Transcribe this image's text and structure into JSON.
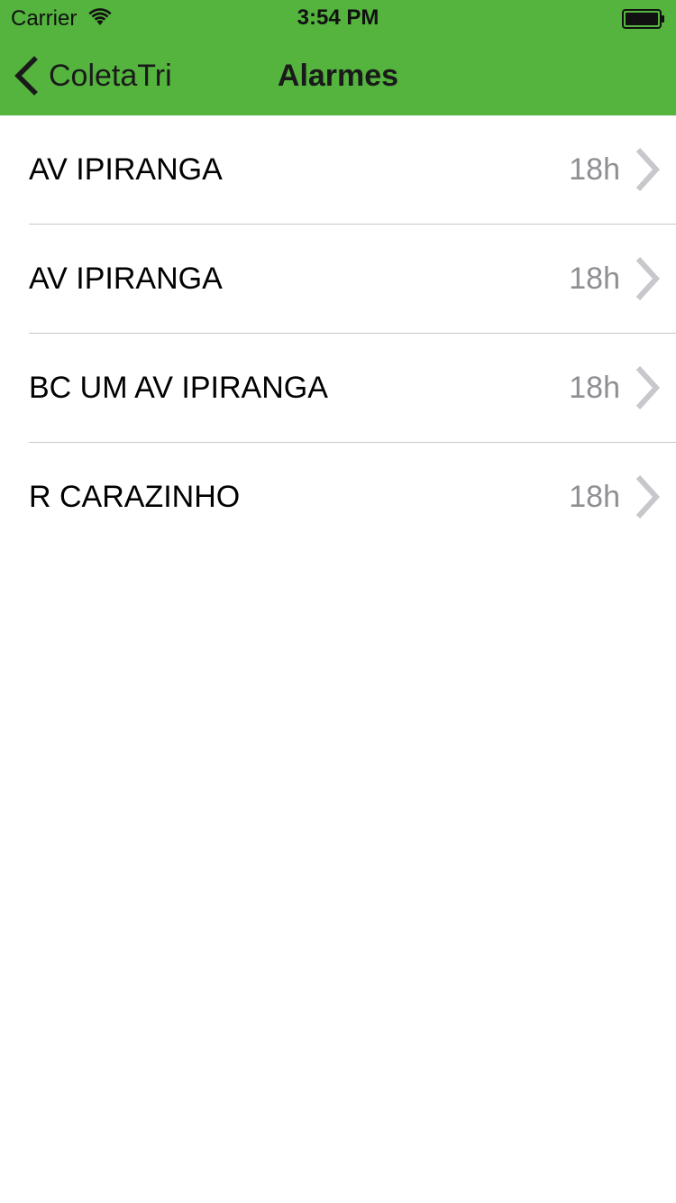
{
  "status_bar": {
    "carrier": "Carrier",
    "time": "3:54 PM",
    "wifi_icon": "wifi-icon",
    "battery_icon": "battery-icon"
  },
  "nav": {
    "back_label": "ColetaTri",
    "title": "Alarmes",
    "back_icon": "chevron-left-icon",
    "bar_color": "#54b43e"
  },
  "alarms": [
    {
      "name": "AV IPIRANGA",
      "time": "18h"
    },
    {
      "name": "AV IPIRANGA",
      "time": "18h"
    },
    {
      "name": "BC UM AV IPIRANGA",
      "time": "18h"
    },
    {
      "name": "R CARAZINHO",
      "time": "18h"
    }
  ]
}
